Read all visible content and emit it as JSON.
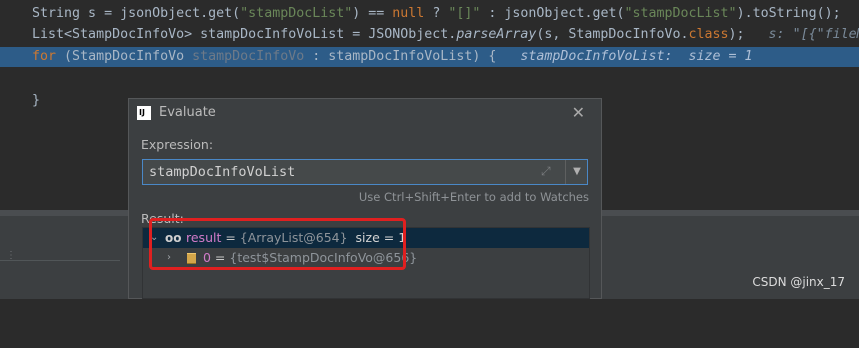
{
  "editor": {
    "line1": {
      "a": "    String s = jsonObject.get(",
      "s1": "\"stampDocList\"",
      "b": ") == ",
      "kw_null": "null",
      "c": " ? ",
      "s2": "\"[]\"",
      "d": " : jsonObject.get(",
      "s3": "\"stampDocList\"",
      "e": ").toString();"
    },
    "line2": {
      "a": "    List<StampDocInfoVo> stampDocInfoVoList = JSONObject.",
      "method": "parseArray",
      "b": "(s, StampDocInfoVo.",
      "kw_class": "class",
      "c": ");   ",
      "hint": "s: \"[{\"fileM"
    },
    "line3": {
      "kw_for": "    for",
      "a": " (StampDocInfoVo ",
      "dim": "stampDocInfoVo",
      "b": " : stampDocInfoVoList) {   ",
      "hint": "stampDocInfoVoList:  size = 1"
    },
    "line5": "    }"
  },
  "dialog": {
    "title": "Evaluate",
    "app_icon": "IJ",
    "expression_label": "Expression:",
    "expression_value": "stampDocInfoVoList",
    "watches_hint": "Use Ctrl+Shift+Enter to add to Watches",
    "result_label": "Result:",
    "result": {
      "name": "result",
      "eq": " = ",
      "ref": "{ArrayList@654}",
      "size": "  size = 1"
    },
    "child": {
      "name": "0",
      "eq": " = ",
      "ref": "{test$StampDocInfoVo@656}"
    }
  },
  "watermark": "CSDN @jinx_17",
  "colors": {
    "editor_bg": "#2b2b2b",
    "highlight_line": "#2d5c88",
    "annotation_box": "#e02020",
    "keyword": "#cc7832",
    "string": "#6a8759",
    "variable": "#d17bc9"
  },
  "icons": {
    "close": "close-icon",
    "expand": "expand-icon",
    "dropdown": "chevron-down-icon",
    "watch": "glasses-icon",
    "field": "field-icon"
  }
}
